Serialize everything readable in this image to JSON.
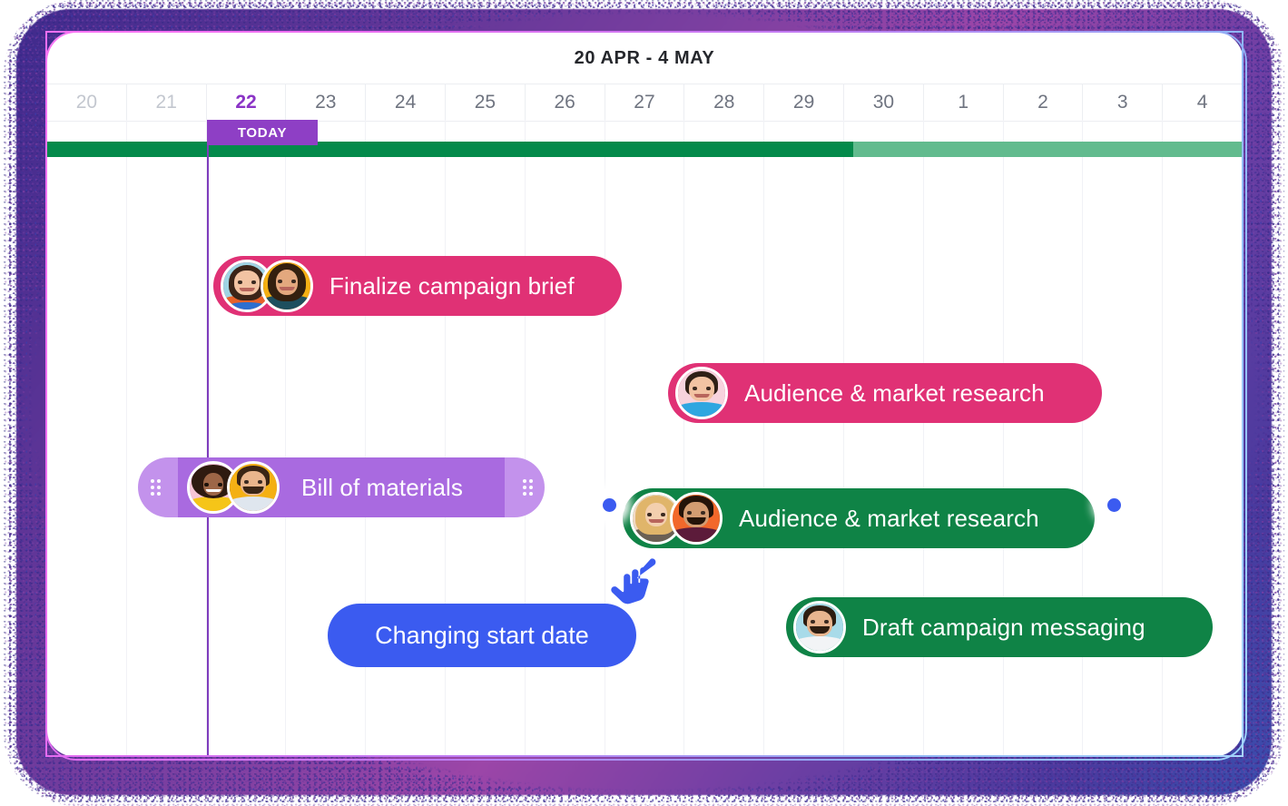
{
  "header": {
    "title": "20 APR - 4 MAY"
  },
  "timeline": {
    "days": [
      {
        "label": "20",
        "state": "muted"
      },
      {
        "label": "21",
        "state": "muted"
      },
      {
        "label": "22",
        "state": "today"
      },
      {
        "label": "23",
        "state": "normal"
      },
      {
        "label": "24",
        "state": "normal"
      },
      {
        "label": "25",
        "state": "normal"
      },
      {
        "label": "26",
        "state": "normal"
      },
      {
        "label": "27",
        "state": "normal"
      },
      {
        "label": "28",
        "state": "normal"
      },
      {
        "label": "29",
        "state": "normal"
      },
      {
        "label": "30",
        "state": "normal"
      },
      {
        "label": "1",
        "state": "normal"
      },
      {
        "label": "2",
        "state": "normal"
      },
      {
        "label": "3",
        "state": "normal"
      },
      {
        "label": "4",
        "state": "normal"
      }
    ],
    "today_label": "TODAY",
    "today_day": "22",
    "progress": {
      "completed_through_day": "29",
      "completed_color": "#048a4b",
      "remaining_color": "#62bb8e"
    }
  },
  "colors": {
    "pink": "#e03175",
    "green": "#0f8346",
    "purple_bar": "#a96ae0",
    "purple_bar_light": "#c392ec",
    "today_purple": "#8e3fc5",
    "accent_blue": "#3b5bf0",
    "day_text": "#6f7480",
    "day_text_muted": "#c3c7cf",
    "gridline": "#f1f2f6"
  },
  "tasks": [
    {
      "id": "finalize-campaign-brief",
      "label": "Finalize campaign brief",
      "color": "pink",
      "avatar_count": 2,
      "draggable": false
    },
    {
      "id": "audience-market-research-pink",
      "label": "Audience & market research",
      "color": "pink",
      "avatar_count": 1,
      "draggable": false
    },
    {
      "id": "bill-of-materials",
      "label": "Bill of materials",
      "color": "purple",
      "avatar_count": 2,
      "draggable": true
    },
    {
      "id": "audience-market-research-green",
      "label": "Audience & market research",
      "color": "green",
      "avatar_count": 2,
      "draggable": false,
      "has_connection_dots": true
    },
    {
      "id": "draft-campaign-messaging",
      "label": "Draft campaign messaging",
      "color": "green",
      "avatar_count": 1,
      "draggable": false
    }
  ],
  "tooltip": {
    "text": "Changing start date",
    "color": "#3b5bf0"
  },
  "cursor": {
    "icon": "pointing-hand-cursor",
    "color": "#3b5bf0"
  }
}
